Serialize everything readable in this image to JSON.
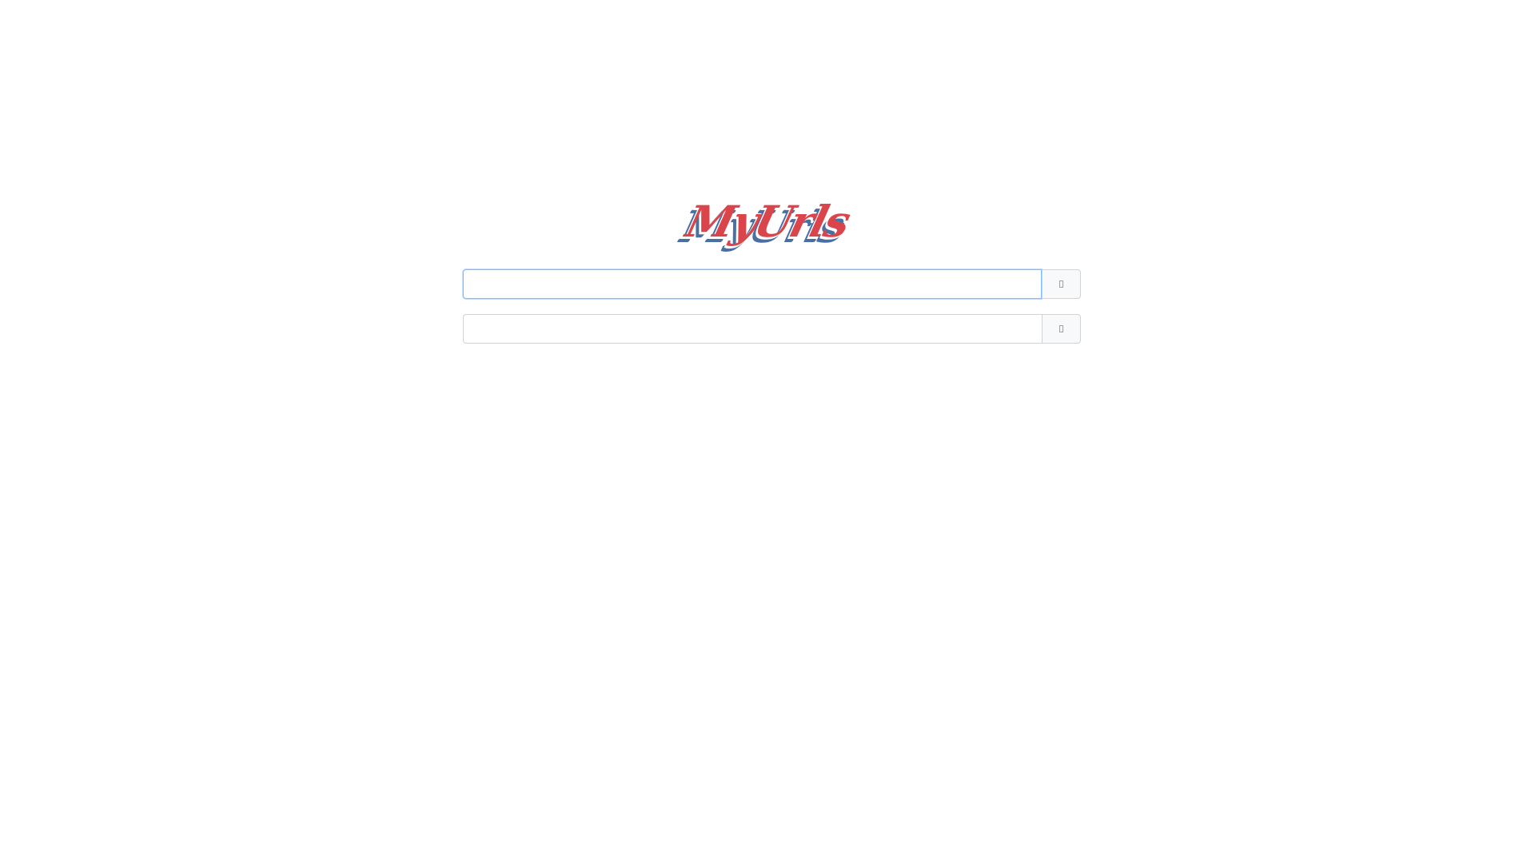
{
  "logo": {
    "text": "MyUrls"
  },
  "form": {
    "long_url": {
      "value": "",
      "placeholder": "",
      "button_icon": "missing-glyph-icon"
    },
    "short_url": {
      "value": "",
      "placeholder": "",
      "button_icon": "missing-glyph-icon"
    }
  },
  "colors": {
    "logo_red": "#d9454a",
    "logo_blue": "#4a6fa5",
    "focus_border": "#80bdff",
    "input_border": "#ced4da",
    "button_bg": "#f8f9fa"
  }
}
